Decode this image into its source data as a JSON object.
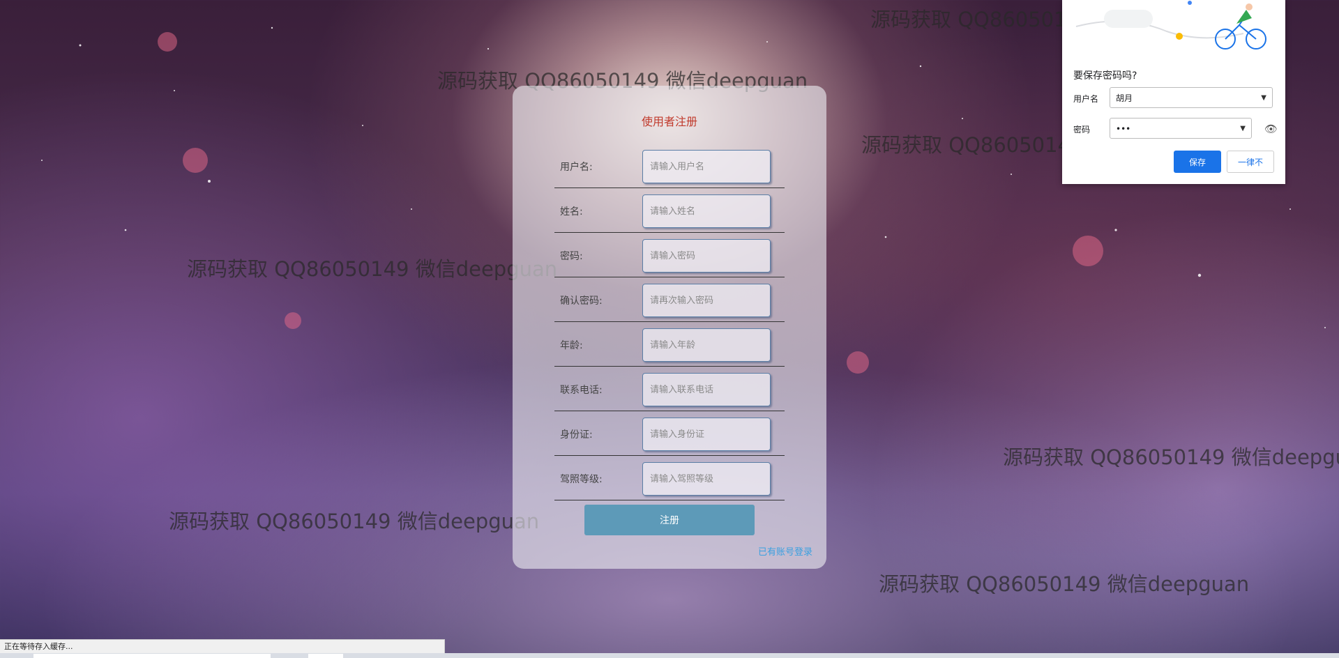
{
  "register": {
    "title": "使用者注册",
    "fields": [
      {
        "label": "用户名:",
        "placeholder": "请输入用户名"
      },
      {
        "label": "姓名:",
        "placeholder": "请输入姓名"
      },
      {
        "label": "密码:",
        "placeholder": "请输入密码"
      },
      {
        "label": "确认密码:",
        "placeholder": "请再次输入密码"
      },
      {
        "label": "年龄:",
        "placeholder": "请输入年龄"
      },
      {
        "label": "联系电话:",
        "placeholder": "请输入联系电话"
      },
      {
        "label": "身份证:",
        "placeholder": "请输入身份证"
      },
      {
        "label": "驾照等级:",
        "placeholder": "请输入驾照等级"
      }
    ],
    "submit_label": "注册",
    "login_link": "已有账号登录"
  },
  "watermark_text": "源码获取 QQ86050149 微信deepguan",
  "password_popup": {
    "title": "要保存密码吗?",
    "username_label": "用户名",
    "username_value": "胡月",
    "password_label": "密码",
    "password_value": "•••",
    "save_label": "保存",
    "never_label": "一律不",
    "accent_color": "#1a73e8"
  },
  "status_bar": {
    "text": "正在等待存入缓存..."
  },
  "colors": {
    "title_red": "#c0392b",
    "submit_blue": "#5d9ab8",
    "link_blue": "#3aa0e0"
  }
}
